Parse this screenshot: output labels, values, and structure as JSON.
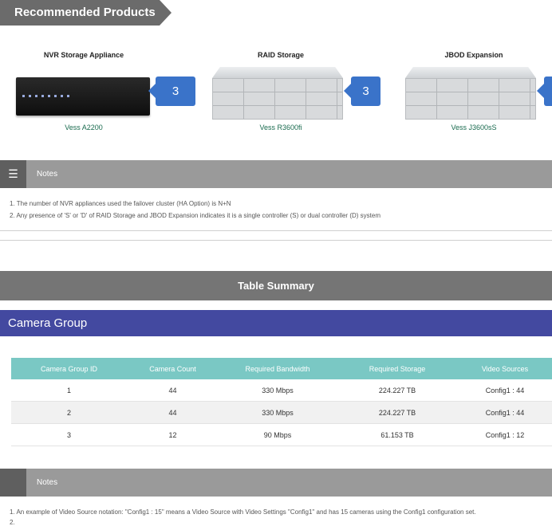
{
  "recommended": {
    "title": "Recommended Products",
    "products": [
      {
        "name": "NVR Storage Appliance",
        "model": "Vess A2200",
        "quantity": "3",
        "icon": "nvr-appliance-image"
      },
      {
        "name": "RAID Storage",
        "model": "Vess R3600fi",
        "quantity": "3",
        "icon": "raid-storage-image"
      },
      {
        "name": "JBOD Expansion",
        "model": "Vess J3600sS",
        "quantity": "",
        "icon": "jbod-expansion-image"
      }
    ]
  },
  "notes_top": {
    "title": "Notes",
    "icon": "list-icon",
    "lines": [
      "1. The number of NVR appliances used the failover cluster (HA Option) is N+N",
      "2. Any presence of 'S' or 'D' of RAID Storage and JBOD Expansion indicates it is a single controller (S) or dual controller (D) system"
    ]
  },
  "table_summary": {
    "title": "Table Summary"
  },
  "camera_group": {
    "title": "Camera Group",
    "columns": [
      "Camera Group ID",
      "Camera Count",
      "Required Bandwidth",
      "Required Storage",
      "Video Sources"
    ],
    "rows": [
      [
        "1",
        "44",
        "330 Mbps",
        "224.227 TB",
        "Config1 : 44"
      ],
      [
        "2",
        "44",
        "330 Mbps",
        "224.227 TB",
        "Config1 : 44"
      ],
      [
        "3",
        "12",
        "90 Mbps",
        "61.153 TB",
        "Config1 : 12"
      ]
    ]
  },
  "notes_bottom": {
    "title": "Notes",
    "lines": [
      "1. An example of Video Source notation: \"Config1 : 15\" means a Video Source with Video Settings \"Config1\" and has 15 cameras using the Config1 configuration set.",
      "2."
    ]
  },
  "colors": {
    "accent_blue": "#3a73c9",
    "camera_group_bar": "#4349a0",
    "table_header": "#7ac8c4",
    "model_text": "#1a6b4f"
  }
}
